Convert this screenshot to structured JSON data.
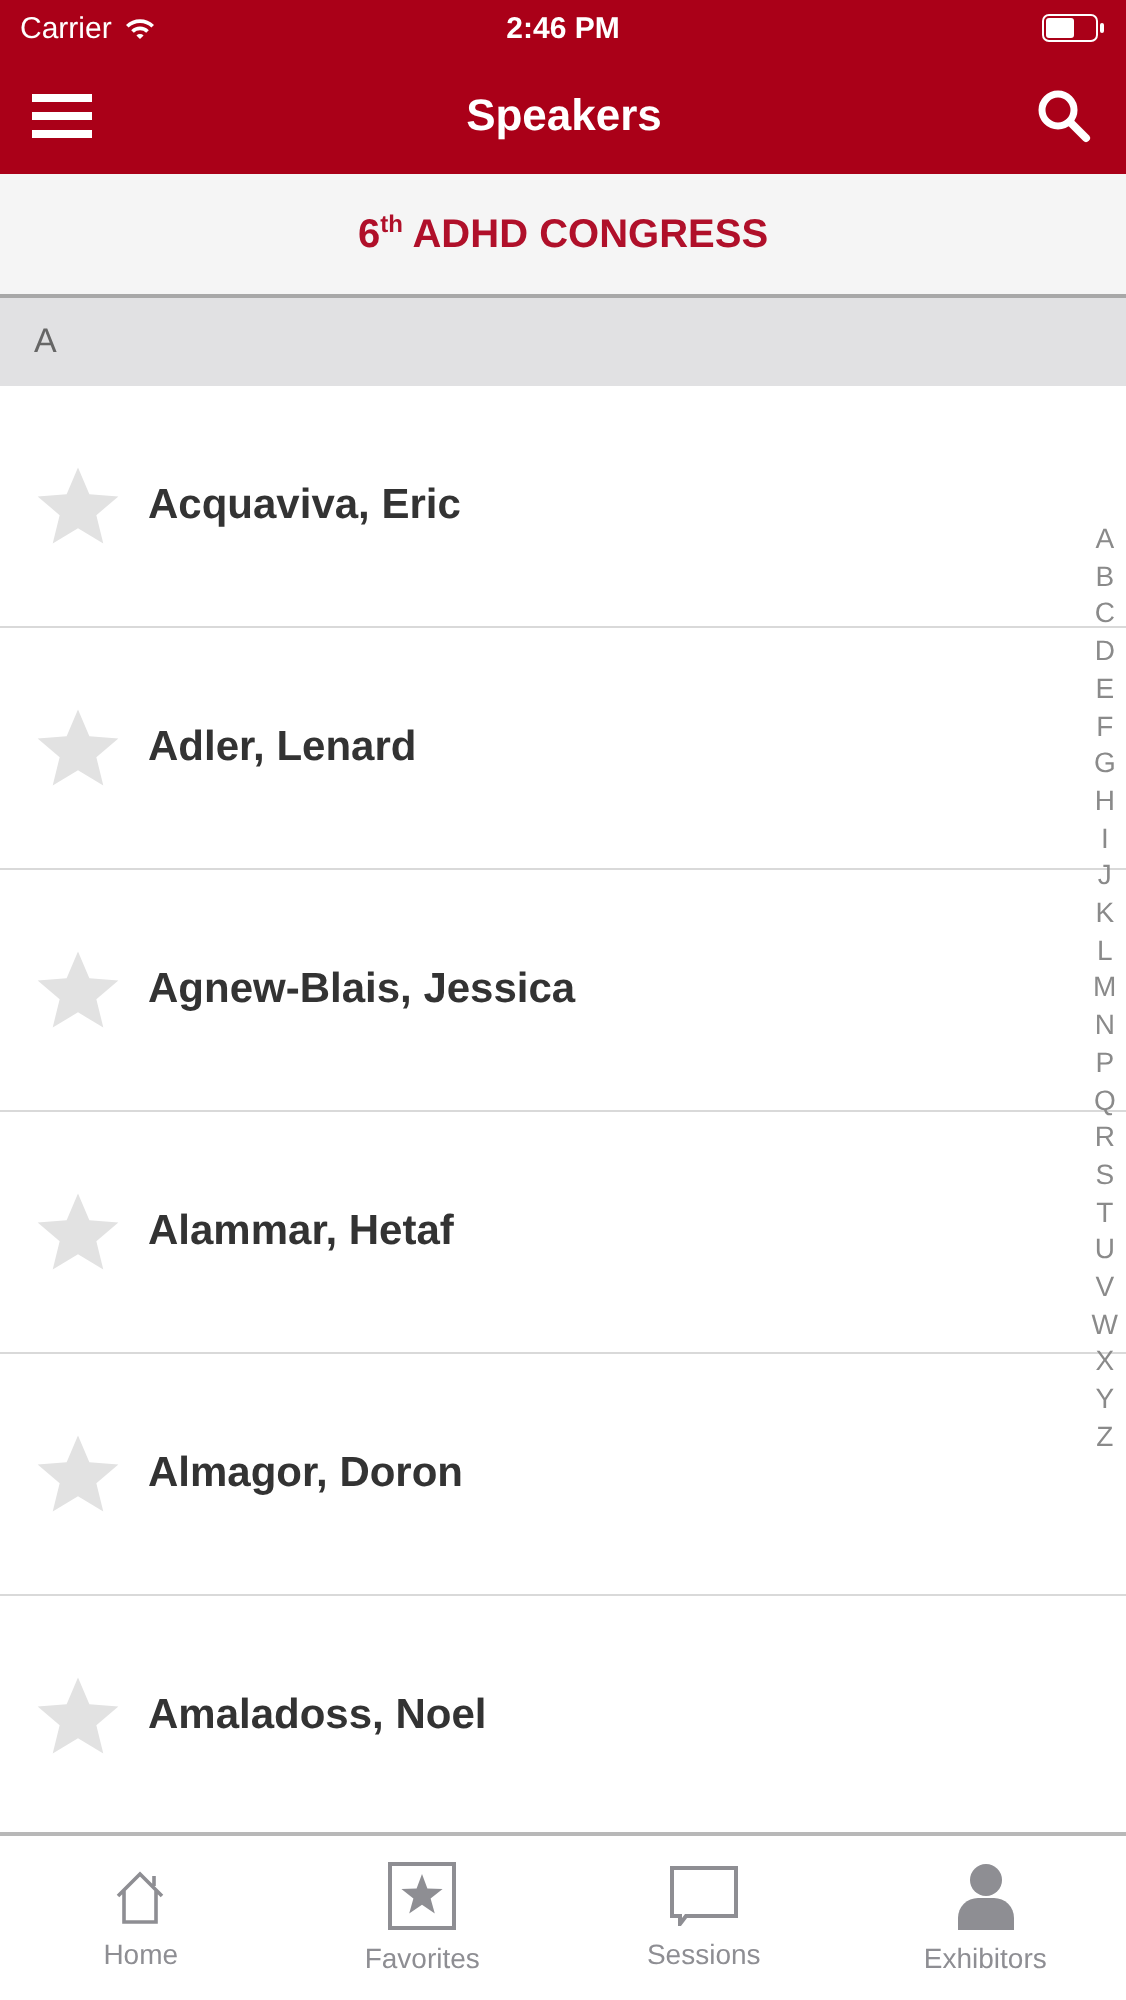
{
  "status_bar": {
    "carrier": "Carrier",
    "time": "2:46 PM"
  },
  "nav_bar": {
    "title": "Speakers"
  },
  "banner": {
    "text": "6$^{th}$ ADHD CONGRESS"
  },
  "sections": [
    {
      "header": "A",
      "speakers": [
        {
          "name": "Acquaviva, Eric",
          "favorite": false
        },
        {
          "name": "Adler, Lenard",
          "favorite": false
        },
        {
          "name": "Agnew-Blais, Jessica",
          "favorite": false
        },
        {
          "name": "Alammar, Hetaf",
          "favorite": false
        },
        {
          "name": "Almagor, Doron",
          "favorite": false
        },
        {
          "name": "Amaladoss, Noel",
          "favorite": false
        }
      ]
    }
  ],
  "index": [
    "A",
    "B",
    "C",
    "D",
    "E",
    "F",
    "G",
    "H",
    "I",
    "J",
    "K",
    "L",
    "M",
    "N",
    "P",
    "Q",
    "R",
    "S",
    "T",
    "U",
    "V",
    "W",
    "X",
    "Y",
    "Z"
  ],
  "tab_bar": [
    {
      "label": "Home",
      "kind": "home",
      "selected": false
    },
    {
      "label": "Favorites",
      "kind": "favorites",
      "selected": false
    },
    {
      "label": "Sessions",
      "kind": "sessions",
      "selected": false
    },
    {
      "label": "Exhibitors",
      "kind": "exhibitors",
      "selected": false
    }
  ]
}
